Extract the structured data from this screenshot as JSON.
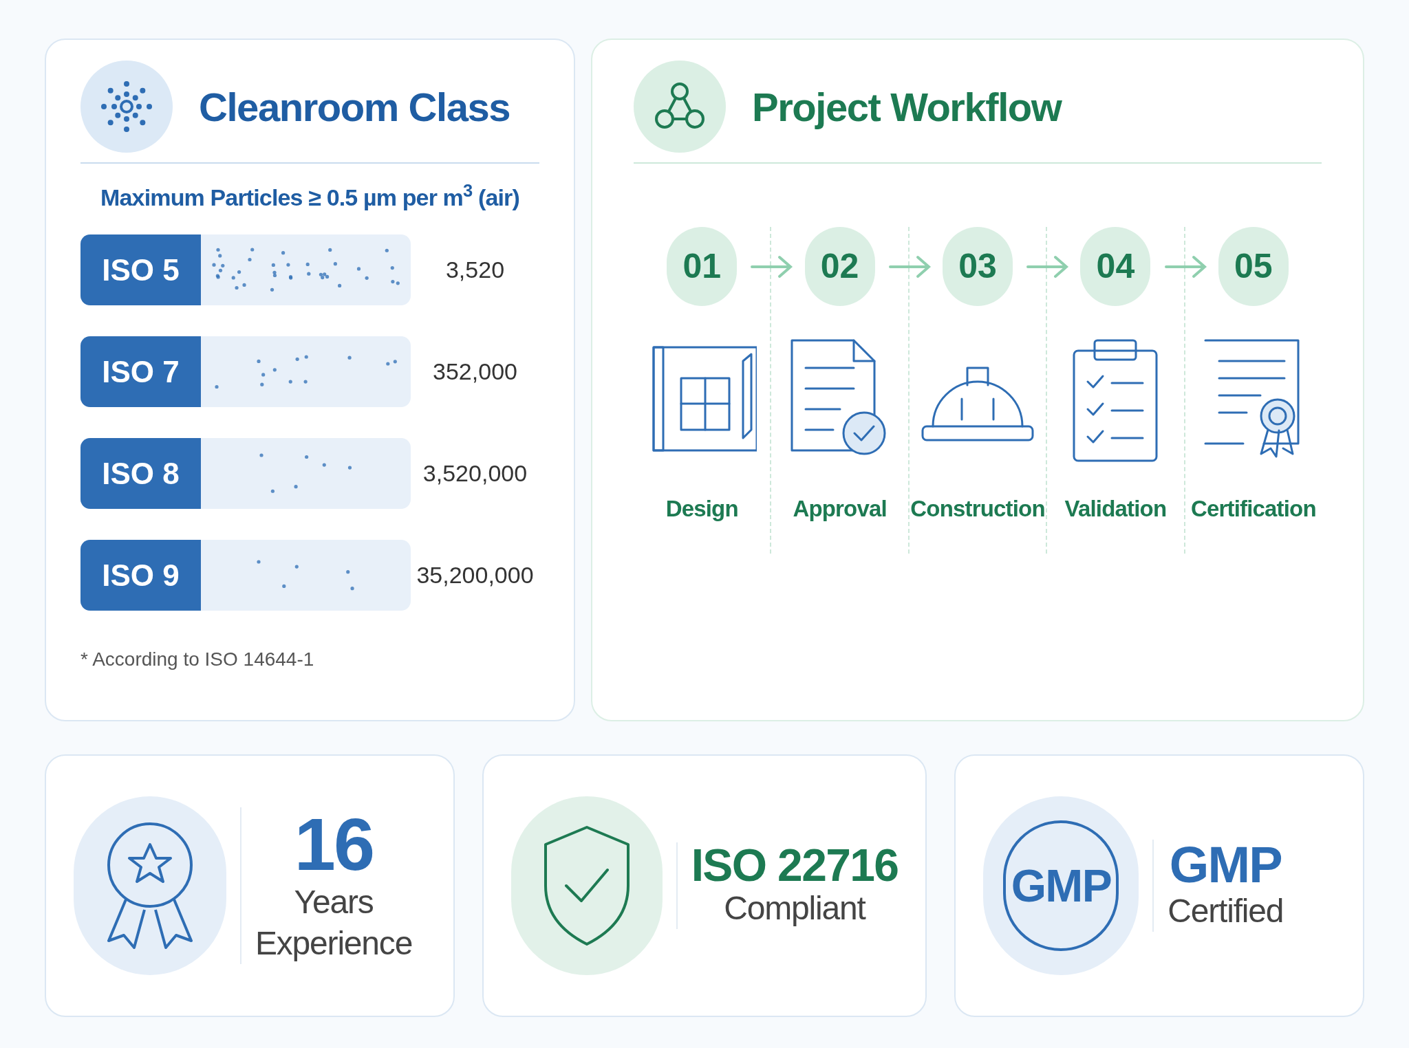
{
  "cleanroom": {
    "title": "Cleanroom Class",
    "subtitle": "Maximum Particles ≥ 0.5 µm per m$^{3}$ (air)",
    "classes": [
      {
        "label": "ISO 5",
        "value": "3,520"
      },
      {
        "label": "ISO 7",
        "value": "352,000"
      },
      {
        "label": "ISO 8",
        "value": "3,520,000"
      },
      {
        "label": "ISO 9",
        "value": "35,200,000"
      }
    ],
    "footnote": "* According to ISO 14644-1"
  },
  "workflow": {
    "title": "Project Workflow",
    "steps": [
      {
        "number": "01",
        "label": "Design",
        "kind": "blueprint"
      },
      {
        "number": "02",
        "label": "Approval",
        "kind": "document"
      },
      {
        "number": "03",
        "label": "Construction",
        "kind": "helmet"
      },
      {
        "number": "04",
        "label": "Validation",
        "kind": "checklist"
      },
      {
        "number": "05",
        "label": "Certification",
        "kind": "certificate"
      }
    ]
  },
  "stats": [
    {
      "kind": "award",
      "headline": "16",
      "lines": [
        "Years",
        "Experience"
      ]
    },
    {
      "kind": "shield",
      "headline": "ISO 22716",
      "lines": [
        "Compliant"
      ]
    },
    {
      "kind": "gmp",
      "headline": "GMP",
      "lines": [
        "Certified"
      ],
      "badge": "GMP"
    }
  ]
}
